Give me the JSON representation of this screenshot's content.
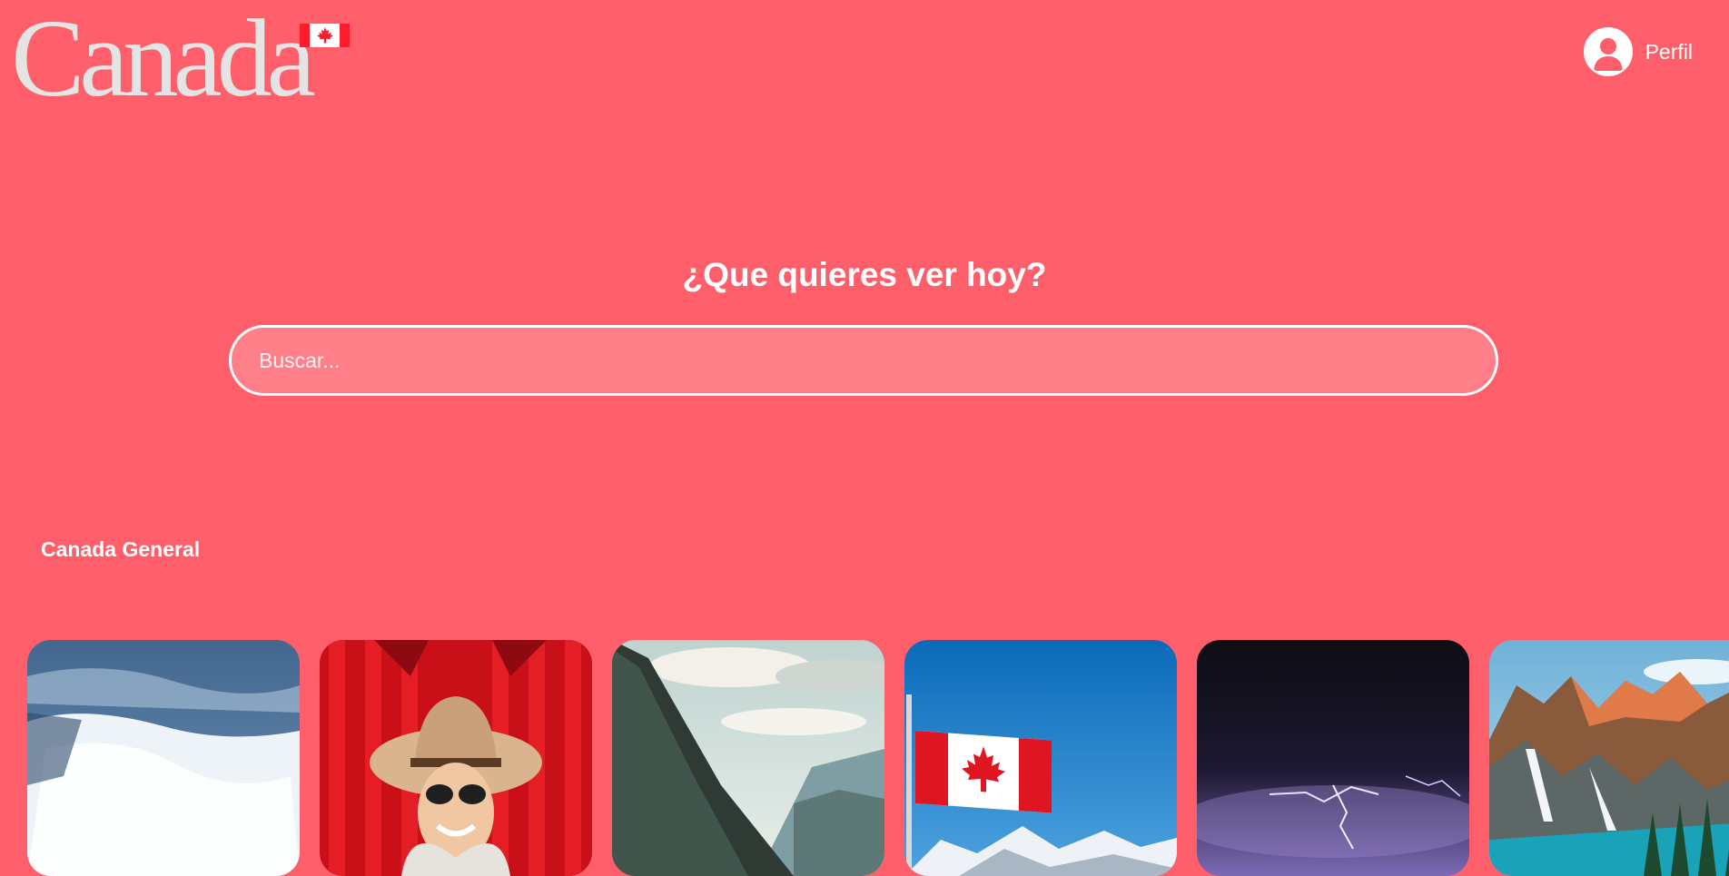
{
  "brand": {
    "wordmark": "Canada",
    "flag_colors": [
      "#ff1c2e",
      "#ffffff"
    ]
  },
  "header": {
    "profile_label": "Perfil",
    "avatar_icon": "user-silhouette-icon"
  },
  "hero": {
    "headline": "¿Que quieres ver hoy?",
    "search_placeholder": "Buscar..."
  },
  "section": {
    "title": "Canada General"
  },
  "colors": {
    "background": "#ff5f6b",
    "search_fill": "#ff8089",
    "text": "#ffffff"
  },
  "cards": [
    {
      "subject": "niagara-falls"
    },
    {
      "subject": "woman-with-hat-red-background"
    },
    {
      "subject": "mountain-valley-clouds"
    },
    {
      "subject": "canadian-flag-sky"
    },
    {
      "subject": "lightning-storm-night"
    },
    {
      "subject": "moraine-lake-mountains"
    }
  ]
}
